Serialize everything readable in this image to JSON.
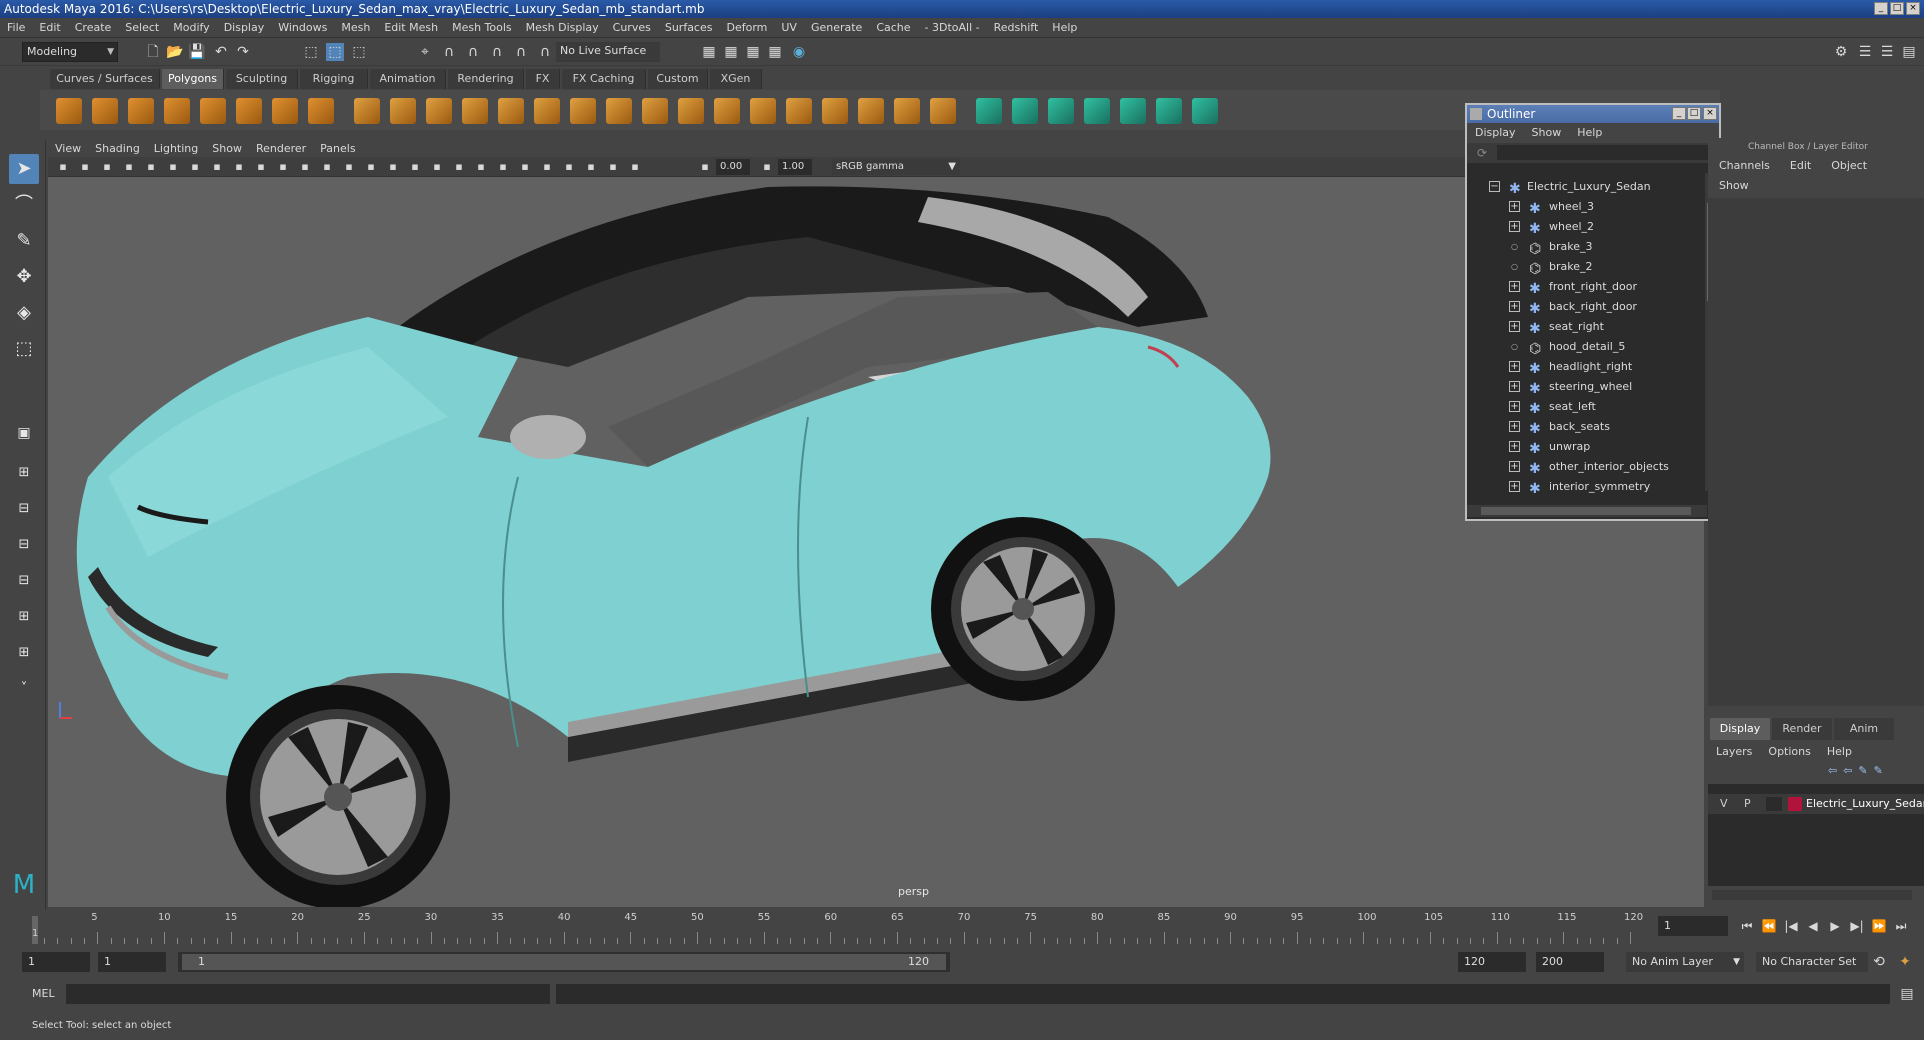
{
  "window": {
    "title": "Autodesk Maya 2016: C:\\Users\\rs\\Desktop\\Electric_Luxury_Sedan_max_vray\\Electric_Luxury_Sedan_mb_standart.mb"
  },
  "menubar": [
    "File",
    "Edit",
    "Create",
    "Select",
    "Modify",
    "Display",
    "Windows",
    "Mesh",
    "Edit Mesh",
    "Mesh Tools",
    "Mesh Display",
    "Curves",
    "Surfaces",
    "Deform",
    "UV",
    "Generate",
    "Cache",
    "- 3DtoAll -",
    "Redshift",
    "Help"
  ],
  "toolbar": {
    "mode": "Modeling",
    "live_surface": "No Live Surface"
  },
  "shelf_tabs": [
    {
      "label": "Curves / Surfaces",
      "active": false
    },
    {
      "label": "Polygons",
      "active": true
    },
    {
      "label": "Sculpting",
      "active": false
    },
    {
      "label": "Rigging",
      "active": false
    },
    {
      "label": "Animation",
      "active": false
    },
    {
      "label": "Rendering",
      "active": false
    },
    {
      "label": "FX",
      "active": false
    },
    {
      "label": "FX Caching",
      "active": false
    },
    {
      "label": "Custom",
      "active": false
    },
    {
      "label": "XGen",
      "active": false
    }
  ],
  "viewport": {
    "menu": [
      "View",
      "Shading",
      "Lighting",
      "Show",
      "Renderer",
      "Panels"
    ],
    "exposure": "0.00",
    "gamma": "1.00",
    "colorspace": "sRGB gamma",
    "camera_label": "persp",
    "car_body_color": "#7fd0d0"
  },
  "outliner": {
    "title": "Outliner",
    "menu": [
      "Display",
      "Show",
      "Help"
    ],
    "root": "Electric_Luxury_Sedan",
    "items": [
      {
        "label": "wheel_3",
        "expand": true,
        "icon": "joint-icon"
      },
      {
        "label": "wheel_2",
        "expand": true,
        "icon": "joint-icon"
      },
      {
        "label": "brake_3",
        "expand": false,
        "icon": "mesh-icon"
      },
      {
        "label": "brake_2",
        "expand": false,
        "icon": "mesh-icon"
      },
      {
        "label": "front_right_door",
        "expand": true,
        "icon": "joint-icon"
      },
      {
        "label": "back_right_door",
        "expand": true,
        "icon": "joint-icon"
      },
      {
        "label": "seat_right",
        "expand": true,
        "icon": "joint-icon"
      },
      {
        "label": "hood_detail_5",
        "expand": false,
        "icon": "mesh-icon"
      },
      {
        "label": "headlight_right",
        "expand": true,
        "icon": "joint-icon"
      },
      {
        "label": "steering_wheel",
        "expand": true,
        "icon": "joint-icon"
      },
      {
        "label": "seat_left",
        "expand": true,
        "icon": "joint-icon"
      },
      {
        "label": "back_seats",
        "expand": true,
        "icon": "joint-icon"
      },
      {
        "label": "unwrap",
        "expand": true,
        "icon": "joint-icon"
      },
      {
        "label": "other_interior_objects",
        "expand": true,
        "icon": "joint-icon"
      },
      {
        "label": "interior_symmetry",
        "expand": true,
        "icon": "joint-icon"
      }
    ]
  },
  "channel_box": {
    "title": "Channel Box / Layer Editor",
    "menu": [
      "Channels",
      "Edit",
      "Object",
      "Show"
    ]
  },
  "layer_editor": {
    "tabs": [
      "Display",
      "Render",
      "Anim"
    ],
    "menu": [
      "Layers",
      "Options",
      "Help"
    ],
    "layer": {
      "v": "V",
      "p": "P",
      "name": "Electric_Luxury_Sedan",
      "color": "#b0143c"
    }
  },
  "timeline": {
    "ticks": [
      "1",
      "5",
      "10",
      "15",
      "20",
      "25",
      "30",
      "35",
      "40",
      "45",
      "50",
      "55",
      "60",
      "65",
      "70",
      "75",
      "80",
      "85",
      "90",
      "95",
      "100",
      "105",
      "110",
      "115",
      "120"
    ],
    "current_frame": "1"
  },
  "range": {
    "start": "1",
    "anim_start": "1",
    "range_start_label": "1",
    "range_end_label": "120",
    "end": "120",
    "anim_end": "200",
    "anim_layer": "No Anim Layer",
    "character_set": "No Character Set"
  },
  "cmdline": {
    "label": "MEL"
  },
  "status": {
    "text": "Select Tool: select an object"
  }
}
